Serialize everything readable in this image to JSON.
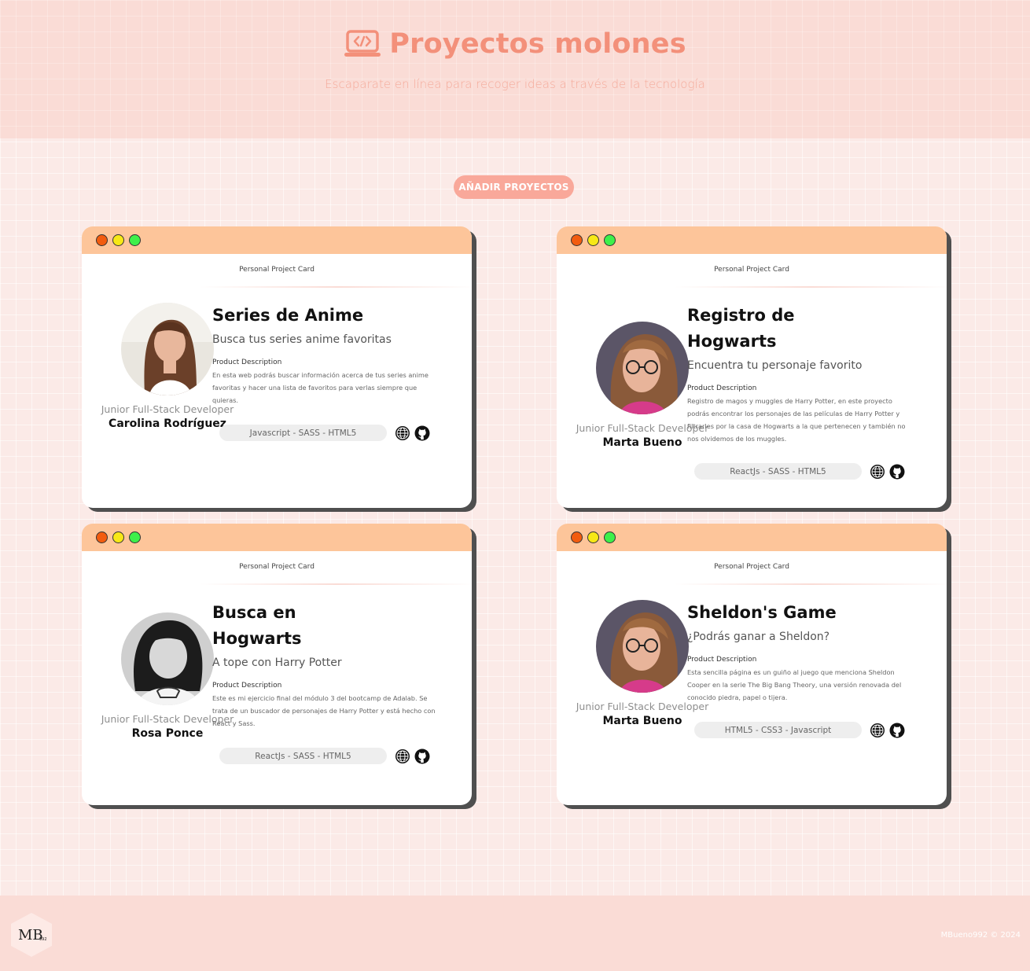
{
  "header": {
    "title": "Proyectos molones",
    "subtitle": "Escaparate en línea para recoger ideas a través de la tecnología",
    "icon": "laptop-code-icon"
  },
  "actions": {
    "add_label": "AÑADIR PROYECTOS"
  },
  "card_label": "Personal Project Card",
  "desc_heading": "Product Description",
  "cards": [
    {
      "title": "Series de Anime",
      "slogan": "Busca tus series anime favoritas",
      "description": "En esta web podrás buscar información acerca de tus series anime favoritas y hacer una lista de favoritos para verlas siempre que quieras.",
      "technologies": "Javascript - SASS - HTML5",
      "job": "Junior Full-Stack Developer",
      "author": "Carolina Rodríguez"
    },
    {
      "title": "Registro de Hogwarts",
      "slogan": "Encuentra tu personaje favorito",
      "description": "Registro de magos y muggles de Harry Potter, en este proyecto podrás encontrar los personajes de las películas de Harry Potter y filtrarles por la casa de Hogwarts a la que pertenecen y también no nos olvidemos de los muggles.",
      "technologies": "ReactJs - SASS - HTML5",
      "job": "Junior Full-Stack Developer",
      "author": "Marta Bueno"
    },
    {
      "title": "Busca en Hogwarts",
      "slogan": "A tope con Harry Potter",
      "description": "Este es mi ejercicio final del módulo 3 del bootcamp de Adalab. Se trata de un buscador de personajes de Harry Potter y está hecho con React y Sass.",
      "technologies": "ReactJs - SASS - HTML5",
      "job": "Junior Full-Stack Developer",
      "author": "Rosa Ponce"
    },
    {
      "title": "Sheldon's Game",
      "slogan": "¿Podrás ganar a Sheldon?",
      "description": "Esta sencilla página es un guiño al juego que menciona Sheldon Cooper en la serie The Big Bang Theory, una versión renovada del conocido piedra, papel o tijera.",
      "technologies": "HTML5 - CSS3 - Javascript",
      "job": "Junior Full-Stack Developer",
      "author": "Marta Bueno"
    }
  ],
  "footer": {
    "logo_text": "MB",
    "logo_sub": "992",
    "copyright": "MBueno992 © 2024"
  },
  "colors": {
    "accent": "#f3907a",
    "card_bar": "#fdc59a",
    "button": "#f9a89a"
  }
}
